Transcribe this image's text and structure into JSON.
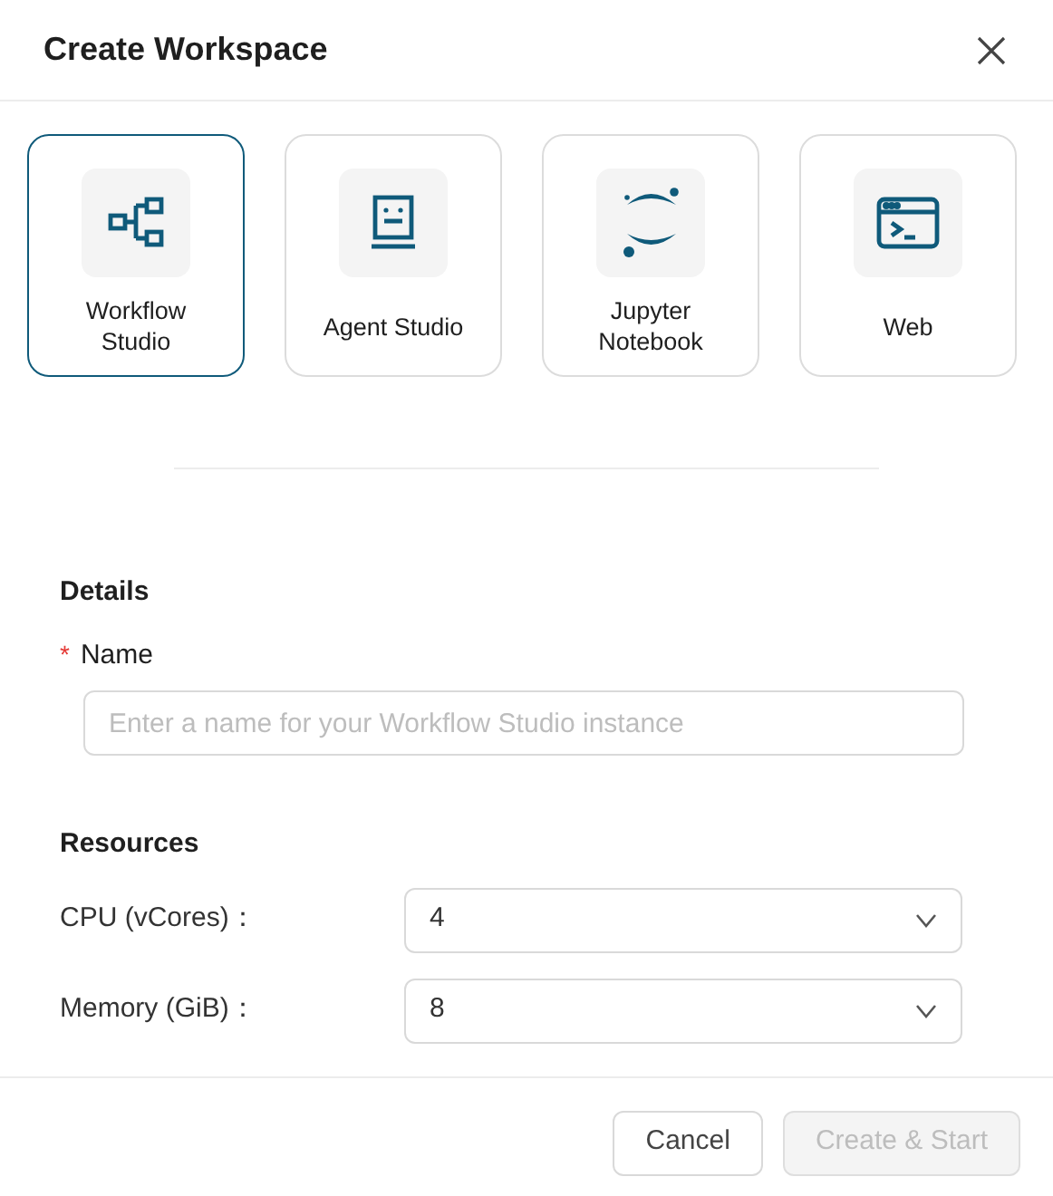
{
  "dialog": {
    "title": "Create Workspace"
  },
  "workspace_types": [
    {
      "kind": "workflow",
      "label": "Workflow Studio",
      "selected": true
    },
    {
      "kind": "agent",
      "label": "Agent Studio",
      "selected": false
    },
    {
      "kind": "jupyter",
      "label": "Jupyter Notebook",
      "selected": false
    },
    {
      "kind": "web",
      "label": "Web",
      "selected": false
    }
  ],
  "details": {
    "heading": "Details",
    "name_field": {
      "required_mark": "*",
      "label": "Name",
      "placeholder": "Enter a name for your Workflow Studio instance"
    }
  },
  "resources": {
    "heading": "Resources",
    "fields": [
      {
        "label": "CPU (vCores)：",
        "value": "4"
      },
      {
        "label": "Memory (GiB)：",
        "value": "8"
      }
    ]
  },
  "buttons": [
    {
      "kind": "cancel",
      "label": "Cancel",
      "disabled": false
    },
    {
      "kind": "create",
      "label": "Create & Start",
      "disabled": true
    }
  ]
}
